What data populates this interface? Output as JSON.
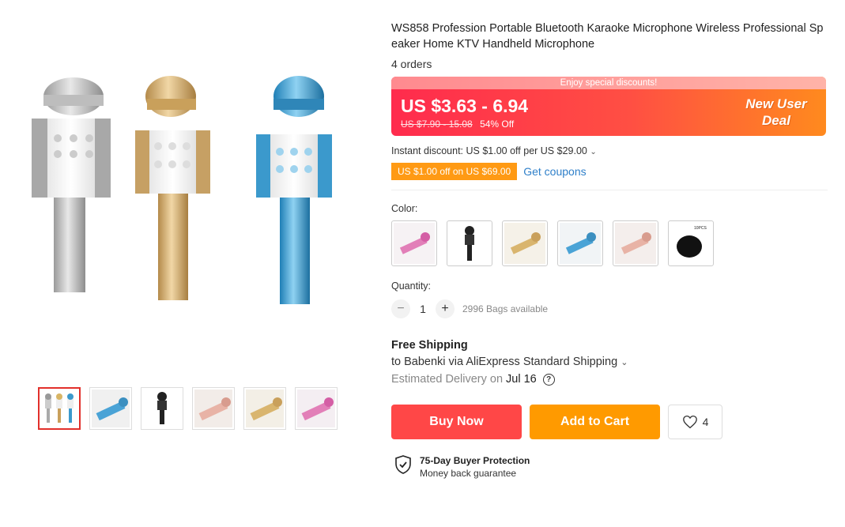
{
  "product": {
    "title": "WS858 Profession Portable Bluetooth Karaoke Microphone Wireless Professional Speaker Home KTV Handheld Microphone",
    "orders": "4 orders"
  },
  "gallery": {
    "thumbnails": [
      "three-mics",
      "blue-mic",
      "black-mic",
      "rose-gold-mic",
      "gold-mic",
      "pink-mic"
    ],
    "active_index": 0
  },
  "price": {
    "banner_text": "Enjoy special discounts!",
    "current": "US $3.63 - 6.94",
    "original": "US $7.90 - 15.08",
    "discount": "54% Off",
    "badge_line1": "New User",
    "badge_line2": "Deal",
    "gradient_colors": [
      "#ff2b4d",
      "#ff4f43",
      "#ff8a1e"
    ]
  },
  "promotions": {
    "instant_discount": "Instant discount: US $1.00 off per US $29.00",
    "coupon": "US $1.00 off on US $69.00",
    "get_coupons": "Get coupons"
  },
  "color": {
    "label": "Color:",
    "options": [
      "pink",
      "black",
      "gold",
      "blue",
      "rose-gold",
      "10pcs-cover"
    ],
    "option_6_text": "10PCS"
  },
  "quantity": {
    "label": "Quantity:",
    "value": "1",
    "minus": "−",
    "plus": "+",
    "available": "2996 Bags available"
  },
  "shipping": {
    "title": "Free Shipping",
    "line": "to Babenki via AliExpress Standard Shipping",
    "delivery_label": "Estimated Delivery on",
    "delivery_date": "Jul 16"
  },
  "actions": {
    "buy_now": "Buy Now",
    "add_to_cart": "Add to Cart",
    "wishlist_count": "4"
  },
  "protection": {
    "title": "75-Day Buyer Protection",
    "subtitle": "Money back guarantee"
  },
  "colors": {
    "buy_now": "#ff4747",
    "add_to_cart": "#ff9a00",
    "coupon_bg": "#ff9a14",
    "link": "#2e7fc9",
    "active_thumb_border": "#e2302b"
  }
}
